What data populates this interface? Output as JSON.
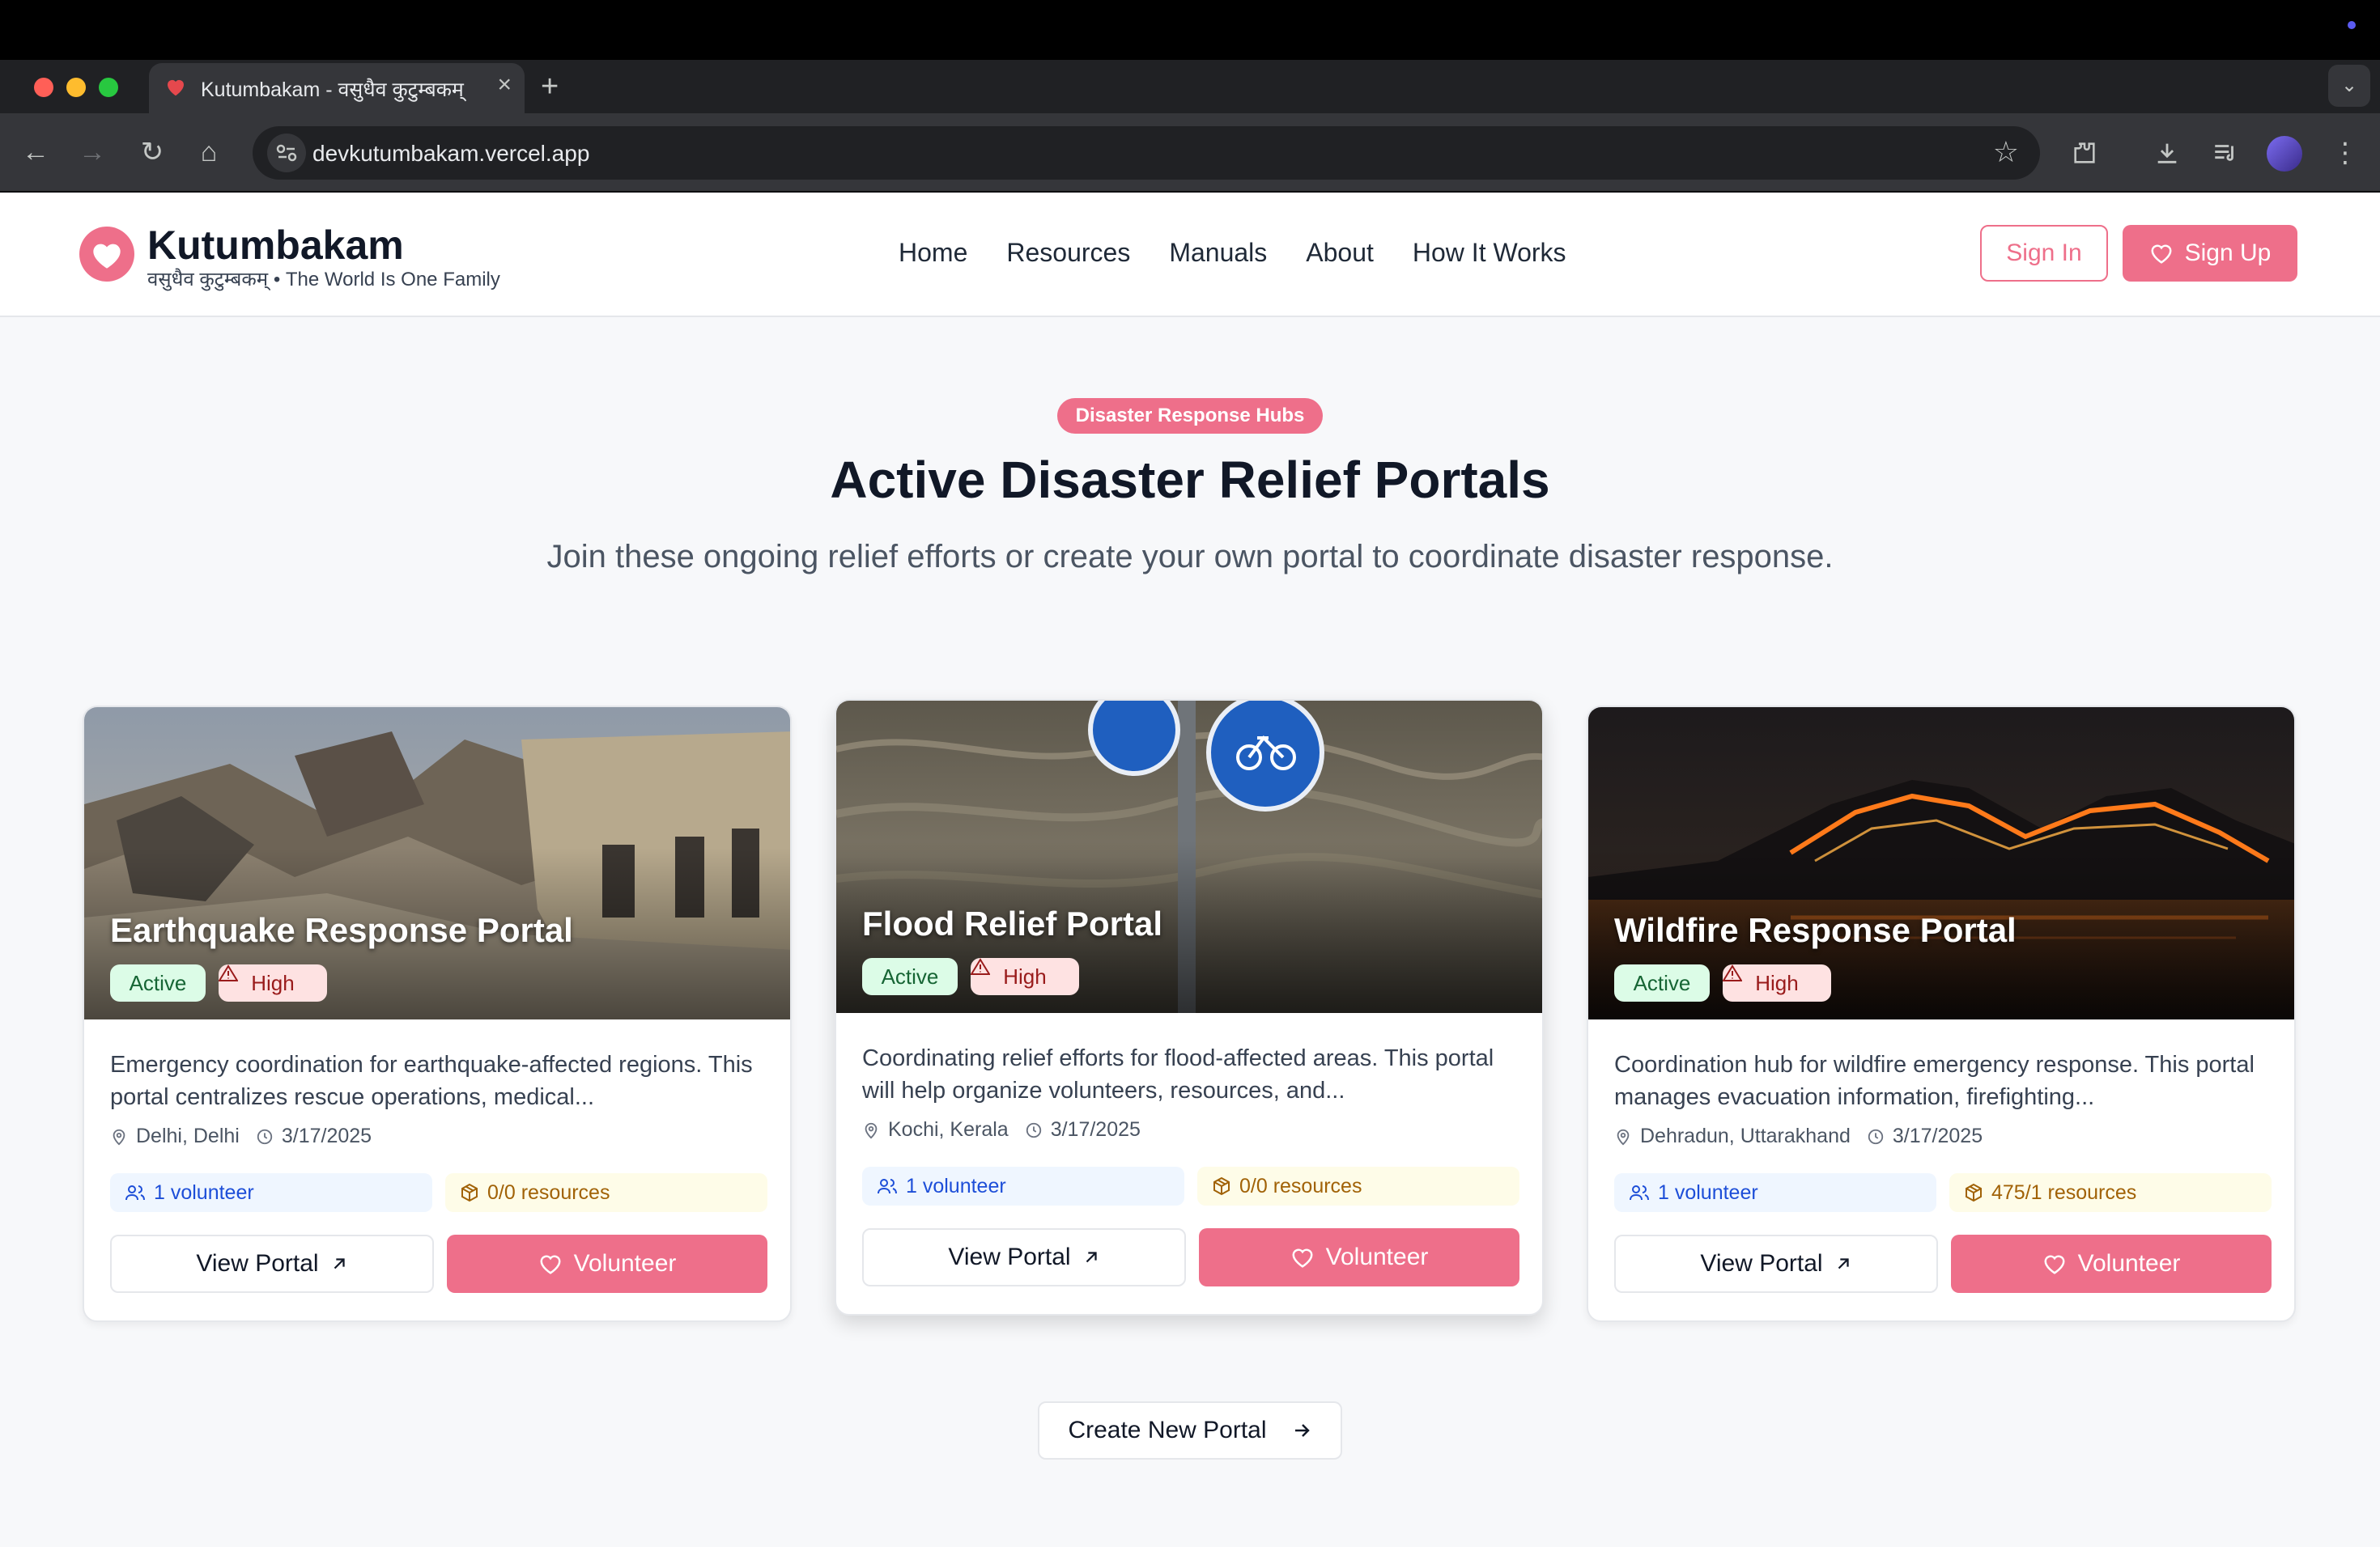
{
  "browser": {
    "tab_title": "Kutumbakam - वसुधैव कुटुम्बकम्",
    "tab_close": "×",
    "new_tab": "+",
    "url": "devkutumbakam.vercel.app"
  },
  "header": {
    "brand": "Kutumbakam",
    "tagline": "वसुधैव कुटुम्बकम् • The World Is One Family",
    "nav": [
      "Home",
      "Resources",
      "Manuals",
      "About",
      "How It Works"
    ],
    "sign_in": "Sign In",
    "sign_up": "Sign Up"
  },
  "hero": {
    "pill": "Disaster Response Hubs",
    "title": "Active Disaster Relief Portals",
    "subtitle": "Join these ongoing relief efforts or create your own portal to coordinate disaster response."
  },
  "cards": [
    {
      "title": "Earthquake Response Portal",
      "status": "Active",
      "severity": "High",
      "description": "Emergency coordination for earthquake-affected regions. This portal centralizes rescue operations, medical...",
      "location": "Delhi, Delhi",
      "date": "3/17/2025",
      "volunteers": "1 volunteer",
      "resources": "0/0 resources",
      "view_label": "View Portal",
      "volunteer_label": "Volunteer"
    },
    {
      "title": "Flood Relief Portal",
      "status": "Active",
      "severity": "High",
      "description": "Coordinating relief efforts for flood-affected areas. This portal will help organize volunteers, resources, and...",
      "location": "Kochi, Kerala",
      "date": "3/17/2025",
      "volunteers": "1 volunteer",
      "resources": "0/0 resources",
      "view_label": "View Portal",
      "volunteer_label": "Volunteer"
    },
    {
      "title": "Wildfire Response Portal",
      "status": "Active",
      "severity": "High",
      "description": "Coordination hub for wildfire emergency response. This portal manages evacuation information, firefighting...",
      "location": "Dehradun, Uttarakhand",
      "date": "3/17/2025",
      "volunteers": "1 volunteer",
      "resources": "475/1 resources",
      "view_label": "View Portal",
      "volunteer_label": "Volunteer"
    }
  ],
  "create_portal": "Create New Portal",
  "colors": {
    "accent": "#ee6f8a",
    "active_bg": "#dcfce7",
    "high_bg": "#fee2e2",
    "volunteer_bg": "#eff6ff",
    "resource_bg": "#fefce8"
  },
  "icons": [
    "heart-icon",
    "map-pin-icon",
    "clock-icon",
    "users-icon",
    "package-icon",
    "alert-triangle-icon",
    "arrow-up-right-icon",
    "arrow-right-icon"
  ]
}
